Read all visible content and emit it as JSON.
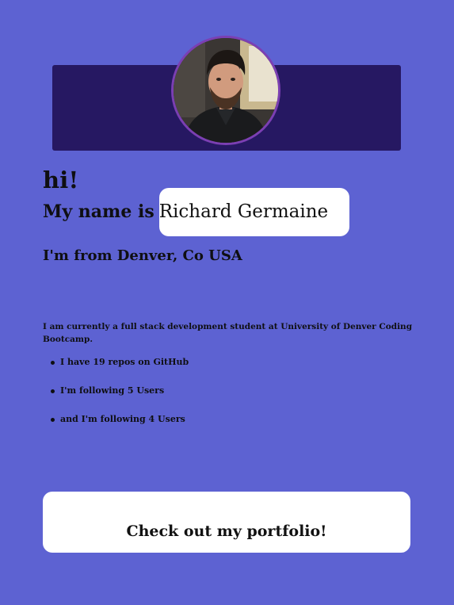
{
  "colors": {
    "background": "#5d62d2",
    "banner": "#261862",
    "avatar_border": "#7b3fb3",
    "card": "#ffffff",
    "text": "#0f0f12"
  },
  "profile": {
    "greeting": "hi!",
    "name_prefix": "My name is",
    "name": "Richard Germaine",
    "location": "I'm from Denver, Co USA",
    "bio": "I am currently a full stack development student at University of Denver Coding Bootcamp."
  },
  "stats": [
    {
      "text": "I have 19 repos on GitHub"
    },
    {
      "text": "I'm following 5 Users"
    },
    {
      "text": "and I'm following 4 Users"
    }
  ],
  "portfolio": {
    "label": "Check out my portfolio!"
  },
  "icons": {
    "avatar": "profile-photo"
  }
}
